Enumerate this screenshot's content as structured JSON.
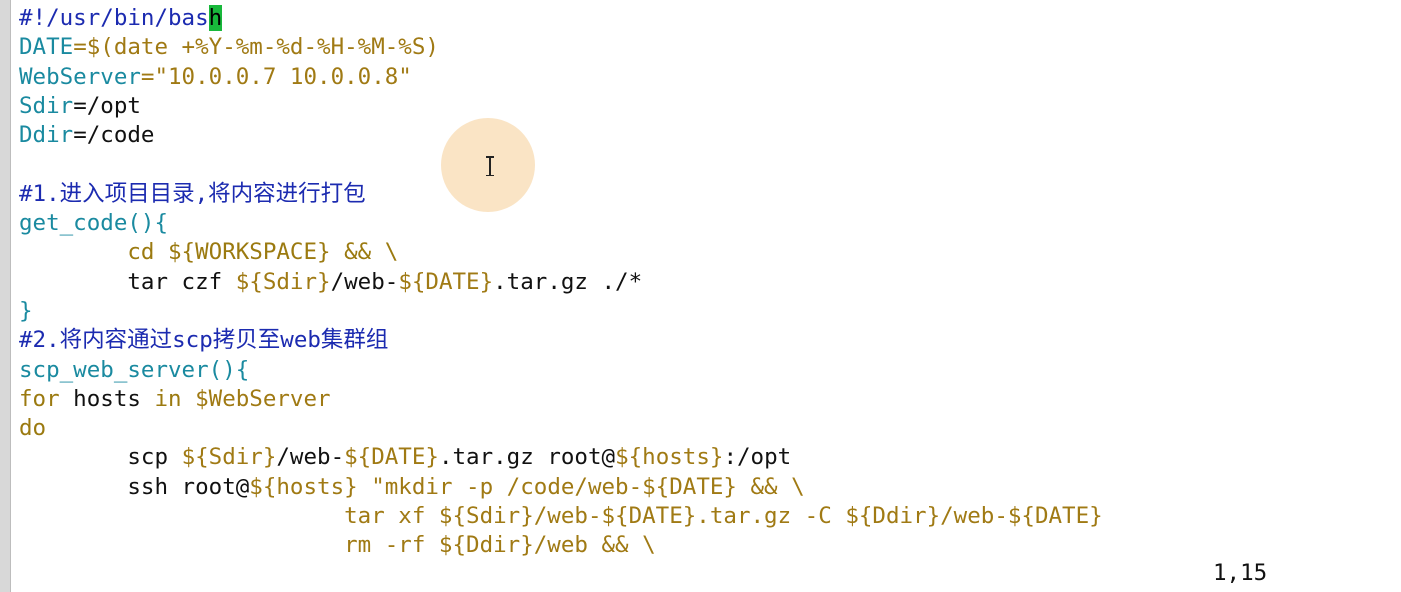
{
  "editor": {
    "lines": [
      [
        {
          "t": "#!/usr/bin/bas",
          "c": "comment"
        },
        {
          "t": "h",
          "c": "cursor"
        }
      ],
      [
        {
          "t": "DATE",
          "c": "var"
        },
        {
          "t": "=$(date +%Y-%m-%d-%H-%M-%S)",
          "c": "str"
        }
      ],
      [
        {
          "t": "WebServer",
          "c": "var"
        },
        {
          "t": "=\"10.0.0.7 10.0.0.8\"",
          "c": "str"
        }
      ],
      [
        {
          "t": "Sdir",
          "c": "var"
        },
        {
          "t": "=/opt",
          "c": "plain"
        }
      ],
      [
        {
          "t": "Ddir",
          "c": "var"
        },
        {
          "t": "=/code",
          "c": "plain"
        }
      ],
      [
        {
          "t": "",
          "c": "plain"
        }
      ],
      [
        {
          "t": "#1.进入项目目录,将内容进行打包",
          "c": "comment"
        }
      ],
      [
        {
          "t": "get_code(){",
          "c": "var"
        }
      ],
      [
        {
          "t": "        cd ${WORKSPACE} && \\",
          "c": "kw"
        }
      ],
      [
        {
          "t": "        tar czf ",
          "c": "plain"
        },
        {
          "t": "${Sdir}",
          "c": "str"
        },
        {
          "t": "/web-",
          "c": "plain"
        },
        {
          "t": "${DATE}",
          "c": "str"
        },
        {
          "t": ".tar.gz ./*",
          "c": "plain"
        }
      ],
      [
        {
          "t": "}",
          "c": "brace"
        }
      ],
      [
        {
          "t": "#2.将内容通过scp拷贝至web集群组",
          "c": "comment"
        }
      ],
      [
        {
          "t": "scp_web_server(){",
          "c": "var"
        }
      ],
      [
        {
          "t": "for",
          "c": "kw"
        },
        {
          "t": " hosts ",
          "c": "plain"
        },
        {
          "t": "in",
          "c": "kw"
        },
        {
          "t": " ",
          "c": "plain"
        },
        {
          "t": "$WebServer",
          "c": "str"
        }
      ],
      [
        {
          "t": "do",
          "c": "kw"
        }
      ],
      [
        {
          "t": "        scp ",
          "c": "plain"
        },
        {
          "t": "${Sdir}",
          "c": "str"
        },
        {
          "t": "/web-",
          "c": "plain"
        },
        {
          "t": "${DATE}",
          "c": "str"
        },
        {
          "t": ".tar.gz root@",
          "c": "plain"
        },
        {
          "t": "${hosts}",
          "c": "str"
        },
        {
          "t": ":/opt",
          "c": "plain"
        }
      ],
      [
        {
          "t": "        ssh root@",
          "c": "plain"
        },
        {
          "t": "${hosts}",
          "c": "str"
        },
        {
          "t": " \"mkdir -p /code/web-${DATE} && \\",
          "c": "str"
        }
      ],
      [
        {
          "t": "                        tar xf ${Sdir}/web-${DATE}.tar.gz -C ${Ddir}/web-${DATE}",
          "c": "str"
        }
      ],
      [
        {
          "t": "                        rm -rf ${Ddir}/web && \\",
          "c": "str"
        }
      ]
    ]
  },
  "status": {
    "cursor_position": "1,15"
  },
  "colors": {
    "comment": "#1c2bb0",
    "var": "#1a8aa0",
    "str": "#a07a14",
    "kw": "#9b7a10",
    "cursor": "#18b83b"
  },
  "icons": {
    "mouse_pointer": "ibeam-cursor-icon"
  }
}
